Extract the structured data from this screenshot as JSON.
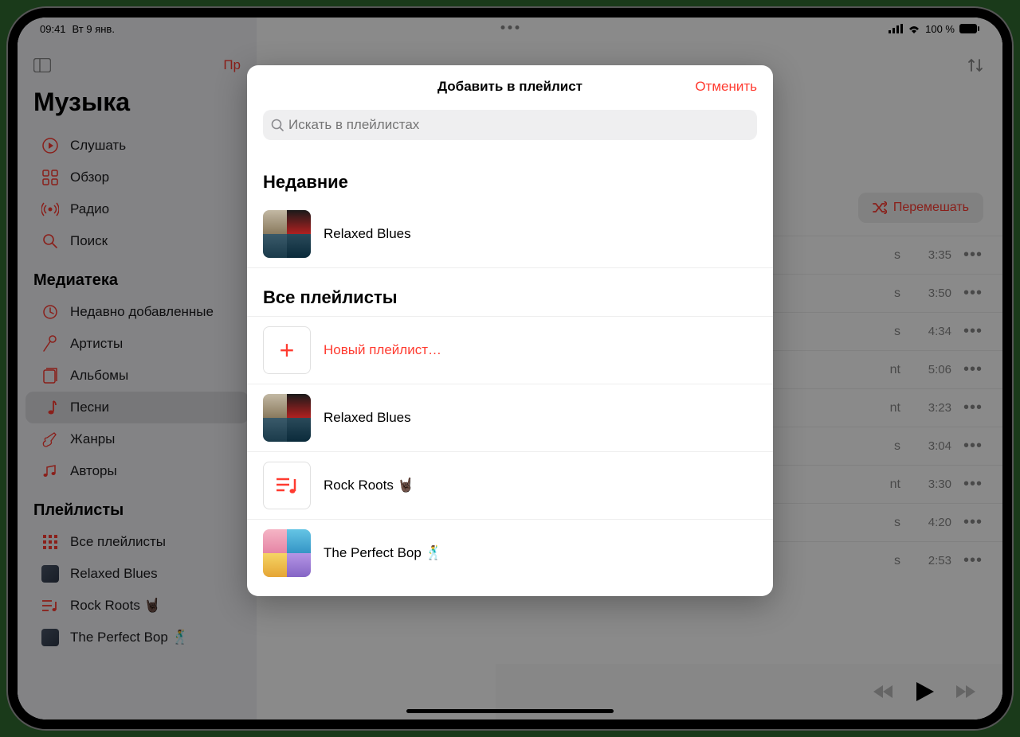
{
  "status": {
    "time": "09:41",
    "date": "Вт 9 янв.",
    "battery": "100 %"
  },
  "app": {
    "title": "Музыка",
    "top_action": "Пр"
  },
  "sidebar": {
    "main": [
      {
        "label": "Слушать",
        "icon": "play-circle"
      },
      {
        "label": "Обзор",
        "icon": "grid"
      },
      {
        "label": "Радио",
        "icon": "radio"
      },
      {
        "label": "Поиск",
        "icon": "search"
      }
    ],
    "library_title": "Медиатека",
    "library": [
      {
        "label": "Недавно добавленные",
        "icon": "clock"
      },
      {
        "label": "Артисты",
        "icon": "mic"
      },
      {
        "label": "Альбомы",
        "icon": "album"
      },
      {
        "label": "Песни",
        "icon": "note",
        "selected": true
      },
      {
        "label": "Жанры",
        "icon": "guitar"
      },
      {
        "label": "Авторы",
        "icon": "notes"
      }
    ],
    "playlists_title": "Плейлисты",
    "playlists": [
      {
        "label": "Все плейлисты",
        "icon": "grid-small"
      },
      {
        "label": "Relaxed Blues",
        "icon": "thumb"
      },
      {
        "label": "Rock Roots 🤘🏿",
        "icon": "playlist"
      },
      {
        "label": "The Perfect Bop 🕺",
        "icon": "thumb"
      }
    ]
  },
  "main": {
    "shuffle_label": "Перемешать",
    "tracks": [
      {
        "suffix": "s",
        "time": "3:35"
      },
      {
        "suffix": "s",
        "time": "3:50"
      },
      {
        "suffix": "s",
        "time": "4:34"
      },
      {
        "suffix": "nt",
        "time": "5:06"
      },
      {
        "suffix": "nt",
        "time": "3:23"
      },
      {
        "suffix": "s",
        "time": "3:04"
      },
      {
        "suffix": "nt",
        "time": "3:30"
      },
      {
        "suffix": "s",
        "time": "4:20"
      },
      {
        "suffix": "s",
        "time": "2:53"
      }
    ]
  },
  "modal": {
    "title": "Добавить в плейлист",
    "cancel": "Отменить",
    "search_placeholder": "Искать в плейлистах",
    "recent_title": "Недавние",
    "recent": [
      {
        "label": "Relaxed Blues",
        "thumb": "relaxed"
      }
    ],
    "all_title": "Все плейлисты",
    "all": [
      {
        "label": "Новый плейлист…",
        "thumb": "new",
        "red": true
      },
      {
        "label": "Relaxed Blues",
        "thumb": "relaxed"
      },
      {
        "label": "Rock Roots 🤘🏿",
        "thumb": "rock"
      },
      {
        "label": "The Perfect Bop 🕺",
        "thumb": "bop"
      }
    ]
  }
}
